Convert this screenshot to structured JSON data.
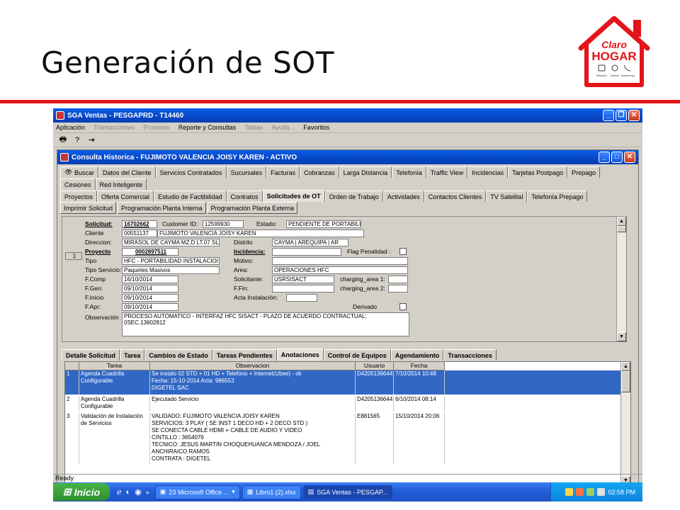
{
  "slide": {
    "title": "Generación de SOT",
    "logo": {
      "line1": "Claro",
      "line2": "HOGAR",
      "captions": [
        "Televisión",
        "Internet",
        "Telefonía fija"
      ],
      "brand_color": "#e3151a"
    }
  },
  "app": {
    "title": "SGA Ventas - PESGAPRD - T14460",
    "menu": [
      {
        "label": "Aplicación",
        "enabled": true
      },
      {
        "label": "Transacciones",
        "enabled": false
      },
      {
        "label": "Procesos",
        "enabled": false
      },
      {
        "label": "Reporte y Consultas",
        "enabled": true
      },
      {
        "label": "Tablas",
        "enabled": false
      },
      {
        "label": "Ayuda...",
        "enabled": false
      },
      {
        "label": "Favoritos",
        "enabled": true
      }
    ],
    "toolbar_icons": [
      "printer-icon",
      "question-icon",
      "exit-icon"
    ],
    "status": "Ready"
  },
  "inner": {
    "title": "Consulta Historica - FUJIMOTO VALENCIA JOISY KAREN - ACTIVO",
    "tabs_row1": [
      "Buscar",
      "Datos del Cliente",
      "Servicios Contratados",
      "Sucursales",
      "Facturas",
      "Cobranzas",
      "Larga Distancia",
      "Telefonía",
      "Traffic View",
      "Incidencias",
      "Tarjetas Postpago",
      "Prepago"
    ],
    "tabs_row2": [
      "Cesiones",
      "Red Inteligente"
    ],
    "tabs_row3": [
      "Proyectos",
      "Oferta Comercial",
      "Estudio de Factibilidad",
      "Contratos",
      "Solicitudes de OT",
      "Orden de Trabajo",
      "Actividades",
      "Contactos Clientes",
      "TV Satelital",
      "Telefonía Prepago"
    ],
    "active_tab": "Solicitudes de OT",
    "buttons": [
      "Imprimir Solicitud",
      "Programación Planta Interna",
      "Programación Planta Externa"
    ],
    "row_counter": "1",
    "form": {
      "solicitud_label": "Solicitud:",
      "solicitud": "16702662",
      "customer_label": "Customer ID:",
      "customer": "12599930",
      "estado_label": "Estado:",
      "estado": "PENDIENTE DE PORTABILII",
      "cliente_label": "Cliente",
      "cliente_id": "00551137",
      "cliente_nombre": "FUJIMOTO VALENCIA JOISY KAREN",
      "direccion_label": "Direccion:",
      "direccion": "MIRASOL DE CAYMA MZ.D LT.07  SL",
      "distrito_label": "Distrito",
      "distrito": "CAYMA | AREQUIPA | AR",
      "proyecto_label": "Proyecto",
      "proyecto": "0002897511",
      "incidencia_label": "Incidencia:",
      "incidencia": "",
      "flag_label": "Flag Penalidad :",
      "tipo_label": "Tipo",
      "tipo": "HFC - PORTABILIDAD INSTALACIOI",
      "motivo_label": "Motivo:",
      "motivo": "",
      "tiposerv_label": "Tipo Servicio:",
      "tiposerv": "Paquetes Masivos",
      "area_label": "Area:",
      "area": "OPERACIONES HFC",
      "fcomp_label": "F.Comp",
      "fcomp": "16/10/2014",
      "solicitante_label": "Solicitante:",
      "solicitante": "USRSISACT",
      "ca1_label": "charging_area 1:",
      "ca1": "",
      "fgen_label": "F.Gen:",
      "fgen": "09/10/2014",
      "ffin_label": "F.Fin:",
      "ffin": "",
      "ca2_label": "charging_area 2:",
      "ca2": "",
      "finicio_label": "F.Inicio",
      "finicio": "09/10/2014",
      "acta_label": "Acta Instalación:",
      "acta": "",
      "fapr_label": "F.Apr:",
      "fapr": "09/10/2014",
      "derivado_label": "Derivado",
      "obs_label": "Observación",
      "obs_line1": "PROCESO AUTOMATICO - INTERFAZ HFC SISACT - PLAZO DE ACUERDO CONTRACTUAL:",
      "obs_line2": "0SEC.13602812"
    },
    "subtabs": [
      "Detalle Solicitud",
      "Tarea",
      "Cambios de Estado",
      "Tareas Pendientes",
      "Anotaciones",
      "Control de Equipos",
      "Agendamiento",
      "Transacciones"
    ],
    "active_subtab": "Anotaciones",
    "grid": {
      "columns": [
        "Tarea",
        "Observacion",
        "Usuario",
        "Fecha"
      ],
      "rows": [
        {
          "n": "1",
          "tarea": [
            "Agenda Cuadrilla",
            "Configurable"
          ],
          "obs": [
            "Se instalo 02 STD + 01 HD +  Telefono + Internet(Ubee) - ok",
            "Fecha: 15-10-2014          Acta: 986553",
            "DIGETEL SAC"
          ],
          "usuario": "D42051366441",
          "fecha": "7/10/2014 10:48",
          "selected": true
        },
        {
          "n": "2",
          "tarea": [
            "Agenda Cuadrilla",
            "Configurable"
          ],
          "obs": [
            "Ejecutado Servicio"
          ],
          "usuario": "D42051366441",
          "fecha": "6/10/2014 08:14",
          "selected": false
        },
        {
          "n": "3",
          "tarea": [
            "Validación de Instalación",
            "de Servicios"
          ],
          "obs": [
            "VALIDADO:  FUJIMOTO VALENCIA JOISY KAREN",
            "SERVICIOS: 3 PLAY ( SE INST 1 DECO HD + 2 DECO STD )",
            "SE CONECTA CABLE HDMI + CABLE DE AUDIO Y VIDEO",
            "CINTILLO : 3654076",
            "TECNICO: JESUS MARTIN CHOQUEHUANCA MENDOZA / JOEL",
            "ANCHIRAICO RAMOS",
            "CONTRATA : DIGETEL"
          ],
          "usuario": "E881565",
          "fecha": "15/10/2014 20:06",
          "selected": false
        }
      ]
    }
  },
  "taskbar": {
    "start": "Inicio",
    "items": [
      {
        "label": "23 Microsoft Office ...",
        "active": false
      },
      {
        "label": "Libro1 (2).xlsx",
        "active": false
      },
      {
        "label": "SGA Ventas - PESGAP...",
        "active": true
      }
    ],
    "clock": "02:58 PM"
  }
}
